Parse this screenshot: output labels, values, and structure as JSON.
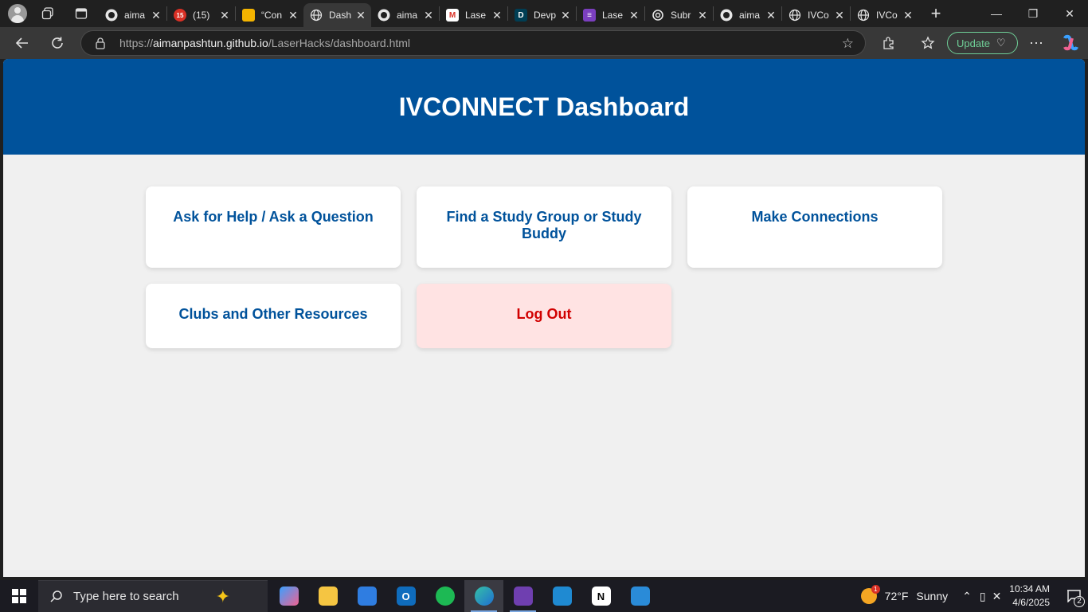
{
  "browser": {
    "tabs": [
      {
        "title": "aima",
        "icon": "github-icon",
        "active": false
      },
      {
        "title": "(15)",
        "icon": "notification-app-icon",
        "badge": "15",
        "active": false
      },
      {
        "title": "“Con",
        "icon": "slides-icon",
        "active": false
      },
      {
        "title": "Dash",
        "icon": "globe-icon",
        "active": true
      },
      {
        "title": "aima",
        "icon": "github-icon",
        "active": false
      },
      {
        "title": "Lase",
        "icon": "gmail-icon",
        "active": false
      },
      {
        "title": "Devp",
        "icon": "devpost-icon",
        "active": false
      },
      {
        "title": "Lase",
        "icon": "forms-icon",
        "active": false
      },
      {
        "title": "Subr",
        "icon": "openai-icon",
        "active": false
      },
      {
        "title": "aima",
        "icon": "github-icon",
        "active": false
      },
      {
        "title": "IVCo",
        "icon": "globe-icon",
        "active": false
      },
      {
        "title": "IVCo",
        "icon": "globe-icon",
        "active": false
      }
    ],
    "url_host": "aimanpashtun.github.io",
    "url_scheme": "https://",
    "url_path": "/LaserHacks/dashboard.html",
    "update_label": "Update"
  },
  "page": {
    "title": "IVCONNECT Dashboard",
    "header_color": "#00529b",
    "cards": [
      {
        "label": "Ask for Help / Ask a Question",
        "name": "ask-for-help-card"
      },
      {
        "label": "Find a Study Group or Study Buddy",
        "name": "find-study-group-card"
      },
      {
        "label": "Make Connections",
        "name": "make-connections-card"
      },
      {
        "label": "Clubs and Other Resources",
        "name": "clubs-resources-card"
      },
      {
        "label": "Log Out",
        "name": "log-out-button"
      }
    ]
  },
  "taskbar": {
    "search_placeholder": "Type here to search",
    "weather_temp": "72°F",
    "weather_text": "Sunny",
    "weather_badge": "1",
    "time": "10:34 AM",
    "date": "4/6/2025",
    "notification_count": "2"
  }
}
